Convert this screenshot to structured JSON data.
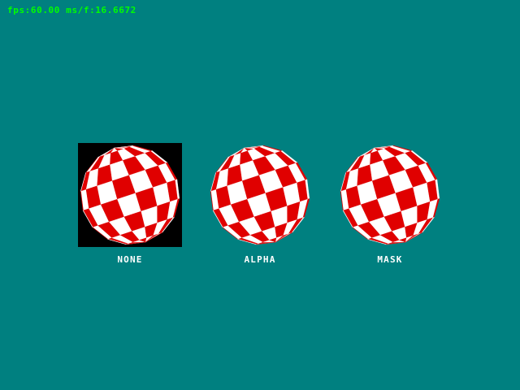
{
  "stats": {
    "fps_text": "fps:60.00 ms/f:16.6672"
  },
  "demos": [
    {
      "label": "NONE"
    },
    {
      "label": "ALPHA"
    },
    {
      "label": "MASK"
    }
  ],
  "colors": {
    "background": "#008080",
    "stats_text": "#00ff00",
    "label_text": "#ffffff",
    "ball_red": "#e00000",
    "ball_white": "#ffffff",
    "sprite_bg_none": "#000000"
  }
}
